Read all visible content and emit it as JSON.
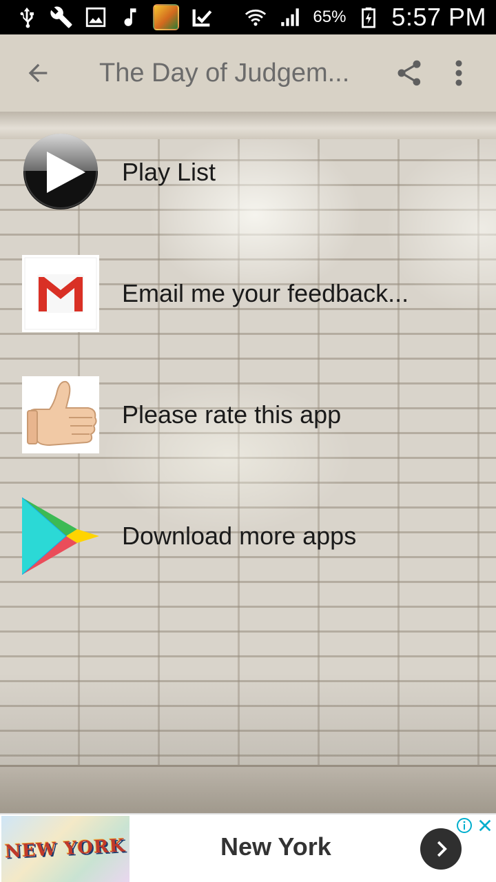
{
  "status_bar": {
    "battery_percent": "65%",
    "time": "5:57 PM",
    "left_icons": [
      "usb-icon",
      "wrench-icon",
      "image-icon",
      "music-note-icon",
      "game-app-icon",
      "checkmark-icon"
    ],
    "right_icons": [
      "wifi-icon",
      "signal-icon",
      "battery-charging-icon"
    ]
  },
  "app_bar": {
    "title": "The Day of Judgem...",
    "back_icon": "arrow-back-icon",
    "share_icon": "share-icon",
    "more_icon": "more-vert-icon",
    "background_color": "#d8d2c6"
  },
  "menu": {
    "items": [
      {
        "label": "Play List",
        "icon": "play-circle-icon"
      },
      {
        "label": "Email me your feedback...",
        "icon": "gmail-icon"
      },
      {
        "label": "Please rate this app",
        "icon": "thumbs-up-icon"
      },
      {
        "label": "Download more apps",
        "icon": "google-play-icon"
      }
    ]
  },
  "ad": {
    "title": "New York",
    "image_text": "NEW YORK",
    "info_icon": "info-icon",
    "close_icon": "close-icon",
    "go_icon": "chevron-right-icon"
  },
  "colors": {
    "status_bar_bg": "#000000",
    "wall_bg": "#d9d4cb",
    "gmail_red": "#d93025",
    "ad_info_blue": "#00aecd"
  }
}
